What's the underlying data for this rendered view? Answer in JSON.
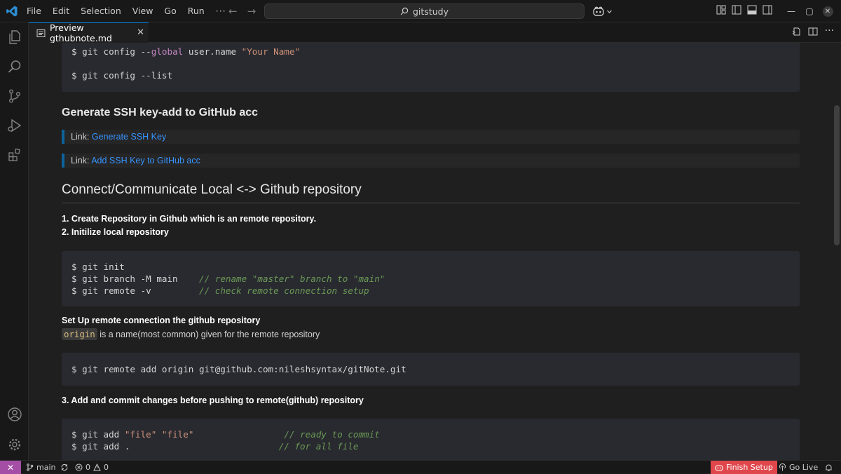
{
  "menu": [
    "File",
    "Edit",
    "Selection",
    "View",
    "Go",
    "Run",
    "···"
  ],
  "command_center": {
    "text": "gitstudy"
  },
  "tab": {
    "label": "Preview gthubnote.md"
  },
  "doc": {
    "code1": {
      "line1_prefix": "$ git config --",
      "line1_kw": "global",
      "line1_mid": " user.name ",
      "line1_str": "\"Your Name\"",
      "line2": "$ git config --list"
    },
    "h_ssh": "Generate SSH key-add to GitHub acc",
    "bq1": {
      "label": "Link: ",
      "link": "Generate SSH Key"
    },
    "bq2": {
      "label": "Link: ",
      "link": "Add SSH Key to GitHub acc"
    },
    "h_connect": "Connect/Communicate Local <-> Github repository",
    "step1": "1. Create Repository in Github which is an remote repository.",
    "step2": "2. Initilize local repository",
    "code2": {
      "l1": "$ git init",
      "l2": "$ git branch -M main    ",
      "l2c": "// rename \"master\" branch to \"main\"",
      "l3": "$ git remote -v         ",
      "l3c": "// check remote connection setup"
    },
    "remote_title": "Set Up remote connection the github repository",
    "remote_code": "origin",
    "remote_desc": " is a name(most common) given for the remote repository",
    "code3": "$ git remote add origin git@github.com:nileshsyntax/gitNote.git",
    "step3": "3. Add and commit changes before pushing to remote(github) repository",
    "code4": {
      "l1a": "$ git add ",
      "l1s1": "\"file\"",
      "l1s2": " ",
      "l1s3": "\"file\"",
      "l1pad": "                 ",
      "l1c": "// ready to commit",
      "l2": "$ git add .                            ",
      "l2c": "// for all file"
    }
  },
  "status": {
    "branch": "main",
    "problems": "0",
    "warnings": "0",
    "finish_setup": "Finish Setup",
    "go_live": "Go Live"
  }
}
